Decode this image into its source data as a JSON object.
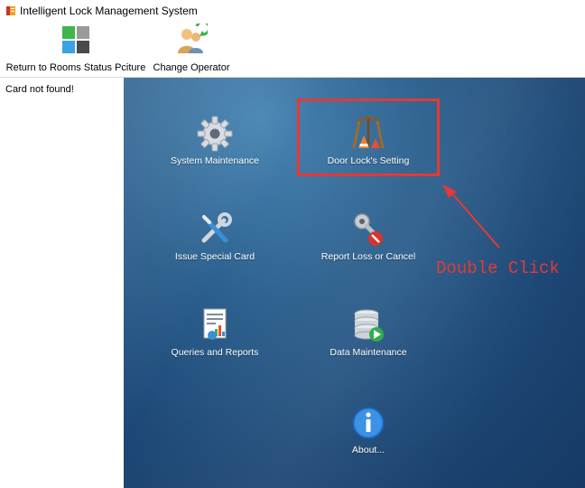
{
  "window": {
    "title": "Intelligent Lock Management System"
  },
  "toolbar": {
    "return_label": "Return to Rooms Status Pciture",
    "change_operator_label": "Change Operator"
  },
  "status": {
    "card_message": "Card not found!"
  },
  "tiles": {
    "system_maintenance": "System Maintenance",
    "door_lock_setting": "Door Lock's Setting",
    "issue_special_card": "Issue Special Card",
    "report_loss": "Report Loss or Cancel",
    "queries_reports": "Queries and Reports",
    "data_maintenance": "Data Maintenance",
    "about": "About..."
  },
  "annotation": {
    "text": "Double Click"
  },
  "colors": {
    "annotation": "#e53935",
    "desktop": "#1d4877"
  }
}
